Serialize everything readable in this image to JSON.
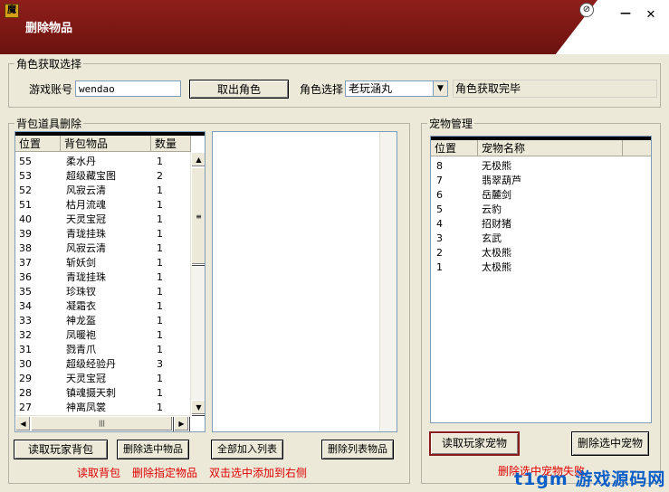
{
  "window": {
    "title": "删除物品",
    "icon_glyph": "魔",
    "pin_glyph": "⊘",
    "min_glyph": "—",
    "close_glyph": "✕"
  },
  "role_section": {
    "legend": "角色获取选择",
    "account_label": "游戏账号",
    "account_value": "wendao",
    "fetch_button": "取出角色",
    "role_label": "角色选择",
    "role_selected": "老玩涵丸",
    "status": "角色获取完毕"
  },
  "bag_section": {
    "legend": "背包道具删除",
    "columns": [
      "位置",
      "背包物品",
      "数量"
    ],
    "rows": [
      [
        "55",
        "柔水丹",
        "1"
      ],
      [
        "53",
        "超级藏宝图",
        "2"
      ],
      [
        "52",
        "风寂云清",
        "1"
      ],
      [
        "51",
        "枯月流魂",
        "1"
      ],
      [
        "40",
        "天灵宝冠",
        "1"
      ],
      [
        "39",
        "青珑挂珠",
        "1"
      ],
      [
        "38",
        "风寂云清",
        "1"
      ],
      [
        "37",
        "斩妖剑",
        "1"
      ],
      [
        "36",
        "青珑挂珠",
        "1"
      ],
      [
        "35",
        "珍珠钗",
        "1"
      ],
      [
        "34",
        "凝霜衣",
        "1"
      ],
      [
        "33",
        "神龙盔",
        "1"
      ],
      [
        "32",
        "凤暖袍",
        "1"
      ],
      [
        "31",
        "戮青爪",
        "1"
      ],
      [
        "30",
        "超级经验丹",
        "3"
      ],
      [
        "29",
        "天灵宝冠",
        "1"
      ],
      [
        "28",
        "镇魂摄天刺",
        "1"
      ],
      [
        "27",
        "神离凤裳",
        "1"
      ]
    ],
    "buttons": {
      "read_bag": "读取玩家背包",
      "delete_selected": "删除选中物品",
      "add_all": "全部加入列表",
      "delete_list": "删除列表物品"
    },
    "hints": {
      "read": "读取背包",
      "delete": "删除指定物品",
      "dblclick": "双击选中添加到右侧"
    }
  },
  "pet_section": {
    "legend": "宠物管理",
    "columns": [
      "位置",
      "宠物名称"
    ],
    "rows": [
      [
        "8",
        "无极熊"
      ],
      [
        "7",
        "翡翠葫芦"
      ],
      [
        "6",
        "岳麓剑"
      ],
      [
        "5",
        "云豹"
      ],
      [
        "4",
        "招财猪"
      ],
      [
        "3",
        "玄武"
      ],
      [
        "2",
        "太极熊"
      ],
      [
        "1",
        "太极熊"
      ]
    ],
    "buttons": {
      "read_pets": "读取玩家宠物",
      "delete_pet": "删除选中宠物"
    },
    "hint": "删除选中宠物失败"
  },
  "icons": {
    "up": "▲",
    "down": "▼",
    "left": "◀",
    "right": "▶",
    "combo_arrow": "▼",
    "grip_v": "≡",
    "grip_h": "|||"
  },
  "watermark": "t1gm 游戏源码网",
  "colors": {
    "title_bar": "#7a1713",
    "hint_red": "#e00000",
    "watermark_blue": "#0a5ec8"
  }
}
